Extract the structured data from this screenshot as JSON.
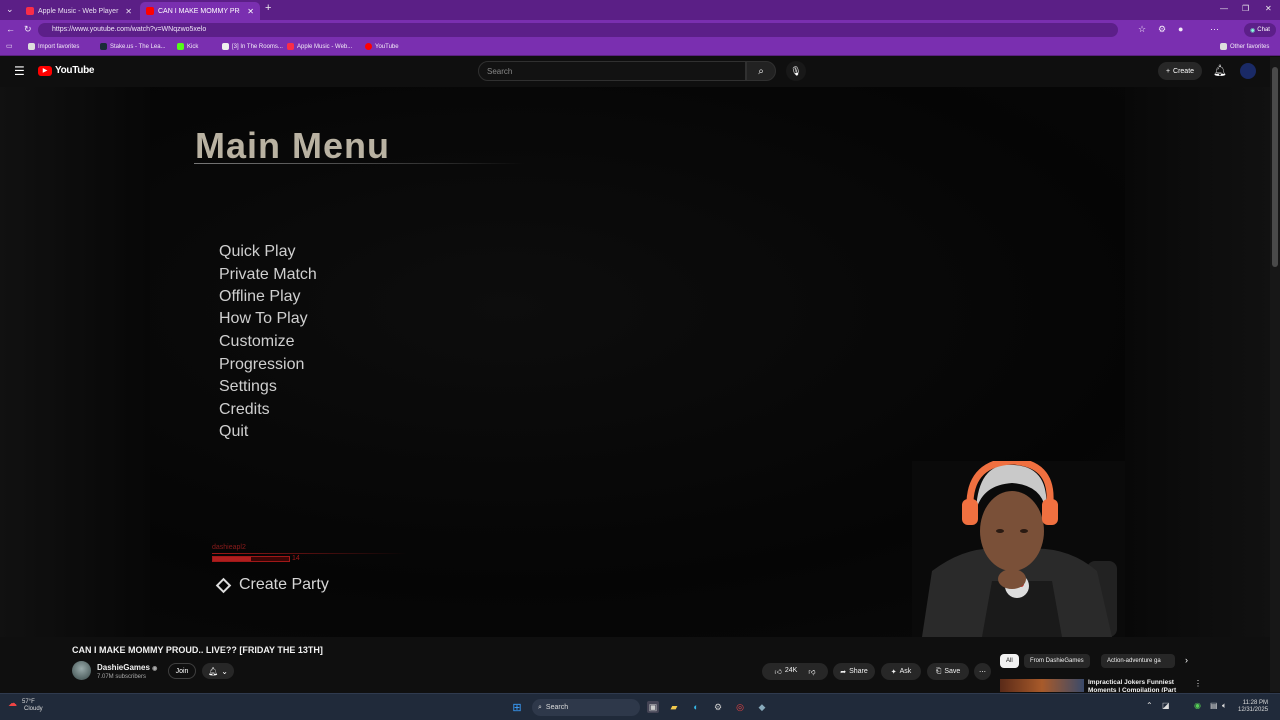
{
  "browser": {
    "tabs": [
      {
        "title": "Apple Music - Web Player",
        "active": false
      },
      {
        "title": "CAN I MAKE MOMMY PROUD",
        "active": true
      }
    ],
    "url": "https://www.youtube.com/watch?v=WNqzwo5xelo",
    "chat_label": "Chat",
    "bookmarks": [
      "Import favorites",
      "Stake.us - The Lea...",
      "Kick",
      "[3] In The Rooms...",
      "Apple Music - Web...",
      "YouTube"
    ],
    "other_favorites": "Other favorites",
    "accent": "#7a2fb0"
  },
  "youtube": {
    "logo": "YouTube",
    "search_placeholder": "Search",
    "create_label": "Create"
  },
  "game": {
    "title": "Main Menu",
    "menu": [
      "Quick Play",
      "Private Match",
      "Offline Play",
      "How To Play",
      "Customize",
      "Progression",
      "Settings",
      "Credits",
      "Quit"
    ],
    "gamertag": "dashieapl2",
    "level": "14",
    "xp_fraction": 0.5,
    "create_party": "Create Party"
  },
  "video": {
    "title": "CAN I MAKE MOMMY PROUD.. LIVE?? [FRIDAY THE 13TH]",
    "channel": "DashieGames",
    "subscribers": "7.07M subscribers",
    "join_label": "Join",
    "likes": "24K",
    "share_label": "Share",
    "ask_label": "Ask",
    "save_label": "Save"
  },
  "recommendations": {
    "chips": [
      "All",
      "From DashieGames",
      "Action-adventure ga"
    ],
    "first_title": "Impractical Jokers Funniest Moments | Compilation (Part"
  },
  "taskbar": {
    "temperature": "57°F",
    "condition": "Cloudy",
    "search_label": "Search",
    "time": "11:28 PM",
    "date": "12/31/2025"
  }
}
